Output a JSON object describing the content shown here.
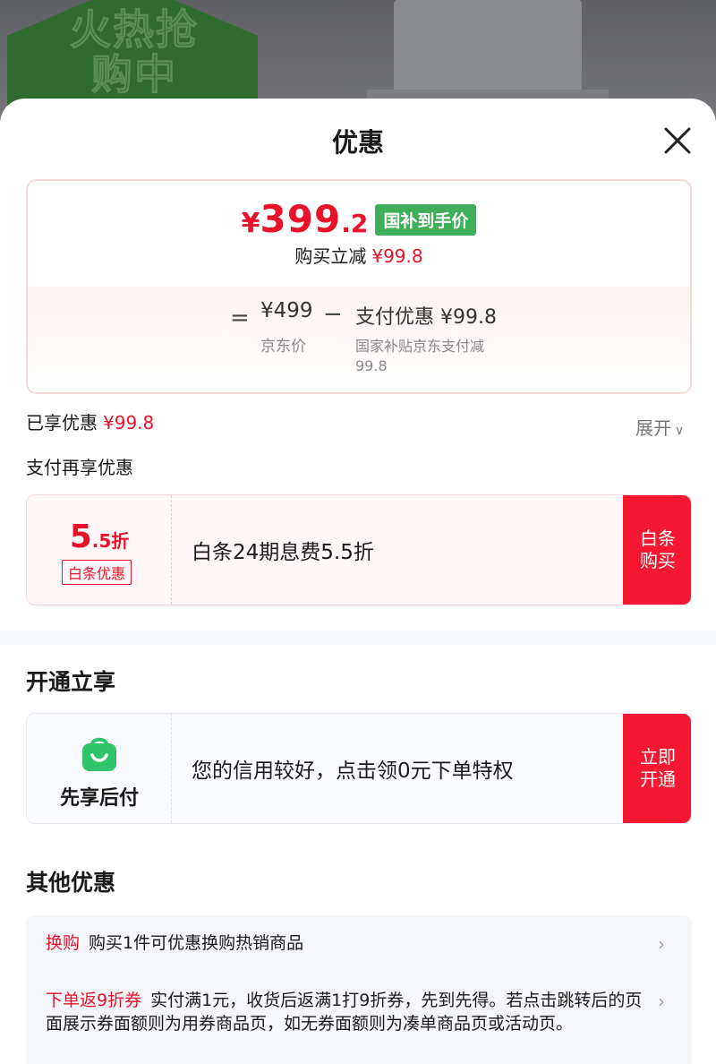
{
  "background": {
    "promo_text": "火热抢购中"
  },
  "sheet": {
    "title": "优惠",
    "close_icon": "close-icon"
  },
  "price_card": {
    "currency": "¥",
    "price_int": "399",
    "price_dec": ".2",
    "badge": "国补到手价",
    "reduce_label": "购买立减",
    "reduce_amount": "¥99.8",
    "equals": "=",
    "jd_price": "¥499",
    "jd_label": "京东价",
    "minus": "−",
    "pay_discount": "支付优惠 ¥99.8",
    "pay_desc": "国家补贴京东支付减99.8"
  },
  "enjoyed": {
    "label": "已享优惠",
    "amount": "¥99.8",
    "expand_label": "展开"
  },
  "pay_more": {
    "title": "支付再享优惠"
  },
  "coupon": {
    "discount_big": "5",
    "discount_small": ".5折",
    "tag": "白条优惠",
    "text": "白条24期息费5.5折",
    "button": "白条购买"
  },
  "open_section": {
    "title": "开通立享",
    "icon": "shopping-bag-icon",
    "label": "先享后付",
    "text": "您的信用较好，点击领0元下单特权",
    "button": "立即开通"
  },
  "other_section": {
    "title": "其他优惠",
    "offers": [
      {
        "tag": "换购",
        "text": "购买1件可优惠换购热销商品"
      },
      {
        "tag": "下单返9折券",
        "text": "实付满1元，收货后返满1打9折券，先到先得。若点击跳转后的页面展示券面额则为用券商品页，如无券面额则为凑单商品页或活动页。"
      }
    ]
  },
  "colors": {
    "accent_red": "#e8122a",
    "button_red": "#f51830",
    "subsidy_green": "#3eae59",
    "bag_green": "#2fc36a"
  }
}
